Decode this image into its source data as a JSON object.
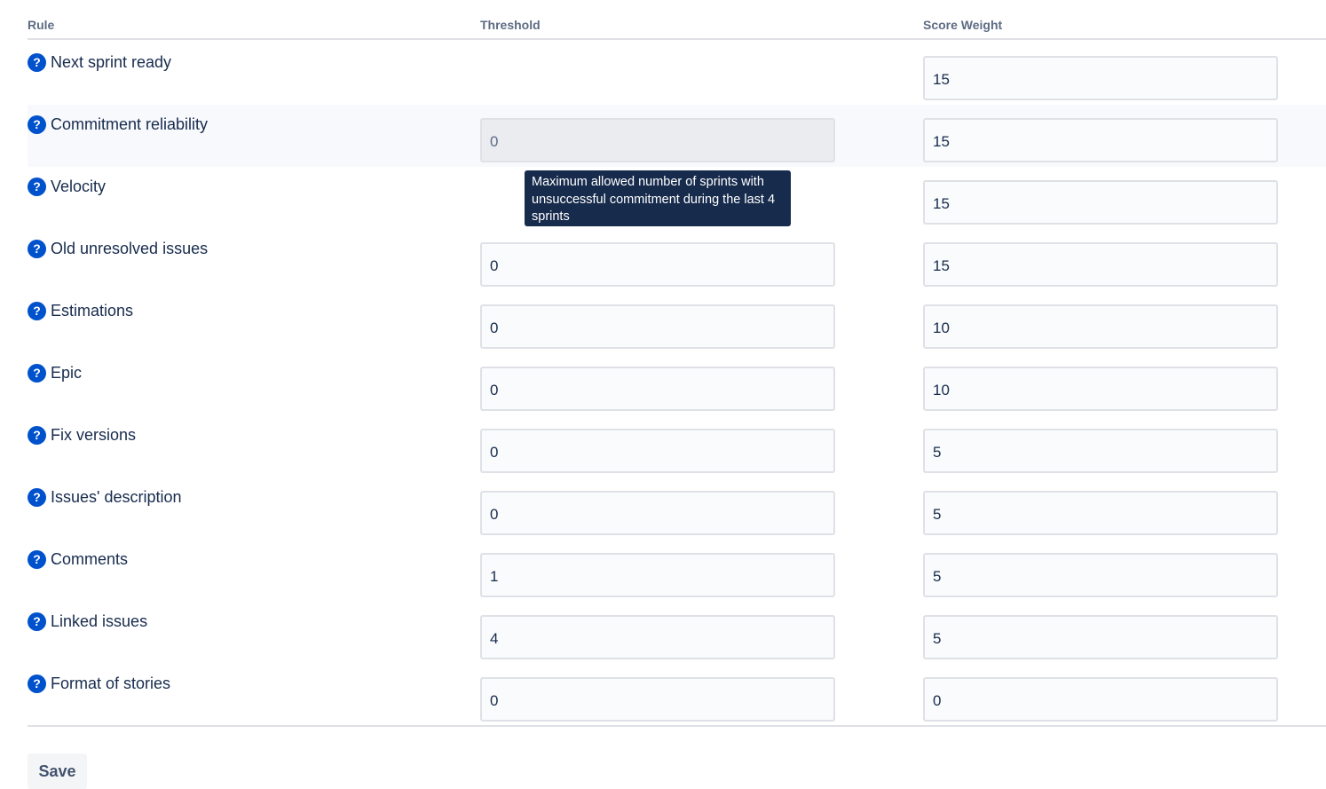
{
  "table": {
    "headers": {
      "rule": "Rule",
      "threshold": "Threshold",
      "weight": "Score Weight"
    },
    "rows": [
      {
        "label": "Next sprint ready",
        "threshold": null,
        "weight": "15"
      },
      {
        "label": "Commitment reliability",
        "threshold": "0",
        "weight": "15",
        "threshold_disabled": true
      },
      {
        "label": "Velocity",
        "threshold": null,
        "weight": "15"
      },
      {
        "label": "Old unresolved issues",
        "threshold": "0",
        "weight": "15"
      },
      {
        "label": "Estimations",
        "threshold": "0",
        "weight": "10"
      },
      {
        "label": "Epic",
        "threshold": "0",
        "weight": "10"
      },
      {
        "label": "Fix versions",
        "threshold": "0",
        "weight": "5"
      },
      {
        "label": "Issues' description",
        "threshold": "0",
        "weight": "5"
      },
      {
        "label": "Comments",
        "threshold": "1",
        "weight": "5"
      },
      {
        "label": "Linked issues",
        "threshold": "4",
        "weight": "5"
      },
      {
        "label": "Format of stories",
        "threshold": "0",
        "weight": "0"
      }
    ]
  },
  "help_icon": {
    "glyph": "?",
    "icon": "question-circle-icon",
    "color": "#0052cc"
  },
  "tooltip": {
    "text": "Maximum allowed number of sprints with unsuccessful commitment during the last 4 sprints"
  },
  "actions": {
    "save_label": "Save"
  },
  "colors": {
    "text": "#172b4d",
    "header_text": "#5e6c84",
    "border": "#dfe1e6",
    "tooltip_bg": "#172b4d",
    "accent": "#0052cc"
  }
}
